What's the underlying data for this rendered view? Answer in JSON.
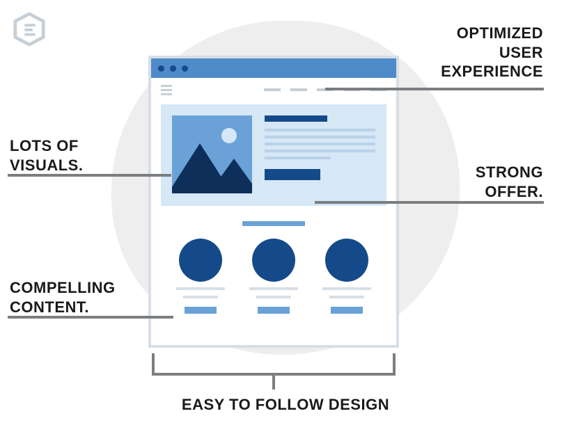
{
  "labels": {
    "optimized": "OPTIMIZED\nUSER\nEXPERIENCE",
    "visuals": "LOTS OF\nVISUALS.",
    "offer": "STRONG\nOFFER.",
    "content": "COMPELLING\nCONTENT.",
    "bottom": "EASY TO FOLLOW DESIGN"
  }
}
